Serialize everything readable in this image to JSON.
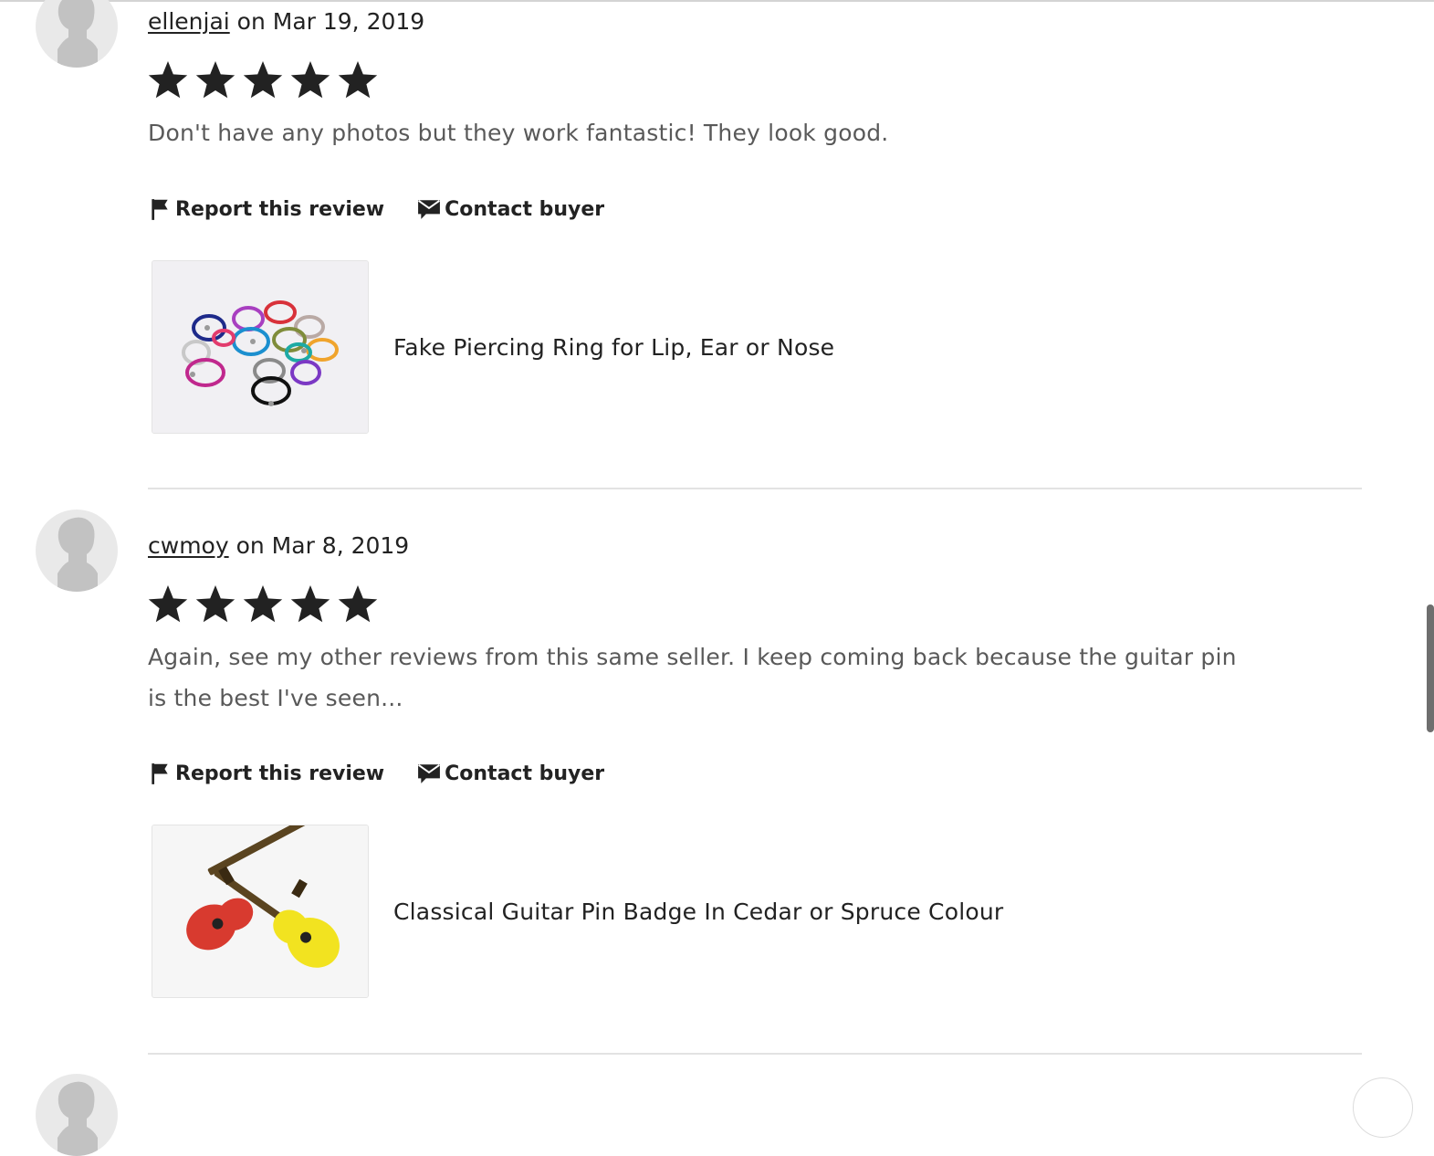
{
  "reviews": [
    {
      "username": "ellenjai",
      "date_text": " on Mar 19, 2019",
      "rating": 5,
      "text": "Don't have any photos but they work fantastic! They look good.",
      "report_label": "Report this review",
      "contact_label": "Contact buyer",
      "product_title": "Fake Piercing Ring for Lip, Ear or Nose"
    },
    {
      "username": "cwmoy",
      "date_text": " on Mar 8, 2019",
      "rating": 5,
      "text": "Again, see my other reviews from this same seller. I keep coming back because the guitar pin is the best I've seen...",
      "report_label": "Report this review",
      "contact_label": "Contact buyer",
      "product_title": "Classical Guitar Pin Badge In Cedar or Spruce Colour"
    }
  ],
  "icons": {
    "avatar": "default-user-avatar-icon",
    "star": "star-icon",
    "report": "flag-icon",
    "contact": "message-icon"
  },
  "colors": {
    "text_primary": "#222222",
    "text_secondary": "#595959",
    "star": "#222222",
    "divider": "#e3e3e3",
    "avatar_bg": "#e9e9e9"
  }
}
